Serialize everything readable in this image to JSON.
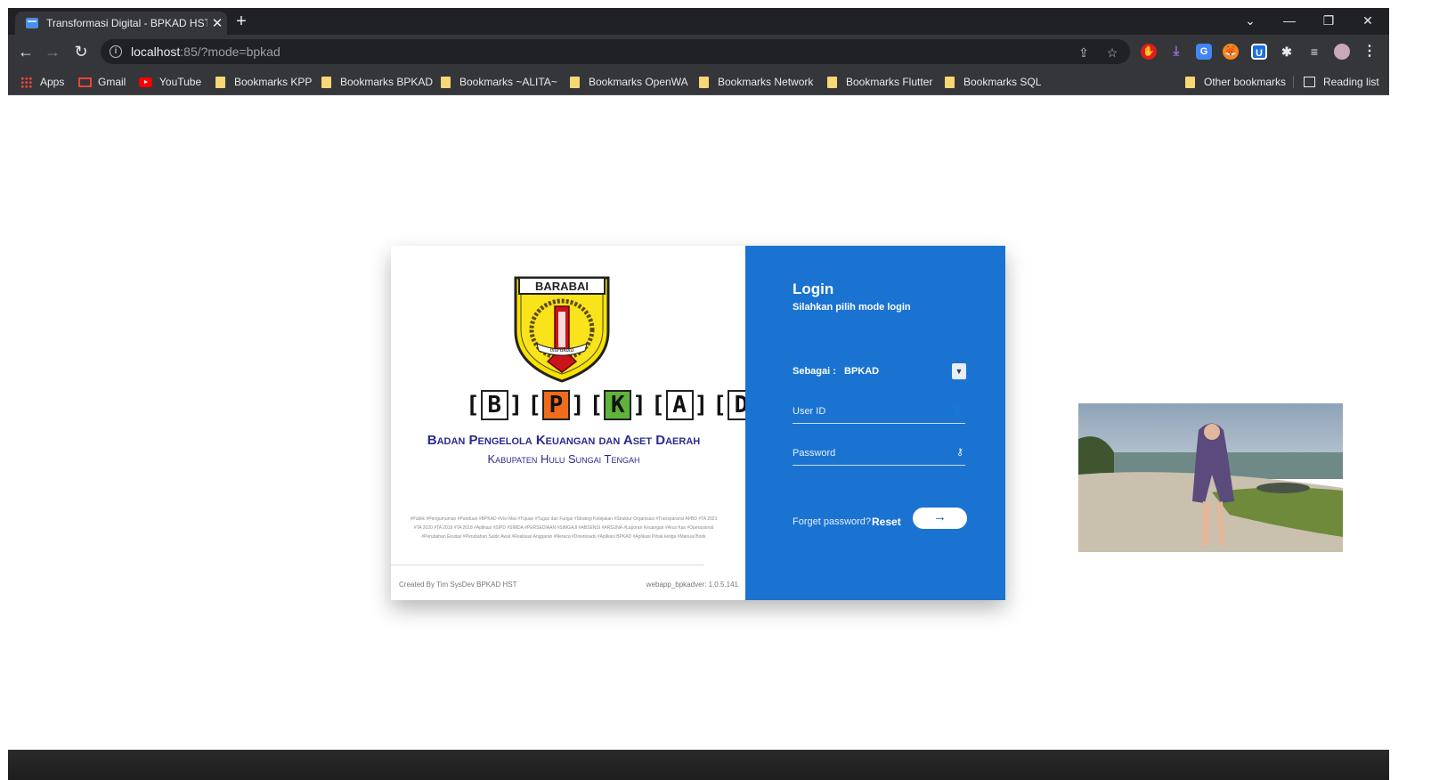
{
  "browser": {
    "tab_title": "Transformasi Digital - BPKAD HST",
    "url_host": "localhost",
    "url_rest": ":85/?mode=bpkad"
  },
  "bookmarks": [
    {
      "label": "Apps",
      "icon": "apps-grid-icon"
    },
    {
      "label": "Gmail",
      "icon": "gmail-icon"
    },
    {
      "label": "YouTube",
      "icon": "youtube-icon"
    },
    {
      "label": "Bookmarks KPP",
      "icon": "folder-icon"
    },
    {
      "label": "Bookmarks BPKAD",
      "icon": "folder-icon"
    },
    {
      "label": "Bookmarks ~ALITA~",
      "icon": "folder-icon"
    },
    {
      "label": "Bookmarks OpenWA",
      "icon": "folder-icon"
    },
    {
      "label": "Bookmarks Network",
      "icon": "folder-icon"
    },
    {
      "label": "Bookmarks Flutter",
      "icon": "folder-icon"
    },
    {
      "label": "Bookmarks SQL",
      "icon": "folder-icon"
    },
    {
      "label": "Other bookmarks",
      "icon": "folder-icon"
    },
    {
      "label": "Reading list",
      "icon": "reading-list-icon"
    }
  ],
  "brand": {
    "crest_top": "BARABAI",
    "crest_ribbon": "murakata",
    "letters": [
      "B",
      "P",
      "K",
      "A",
      "D"
    ],
    "org_name": "Badan Pengelola Keuangan dan Aset Daerah",
    "org_region": "Kabupaten Hulu Sungai Tengah",
    "tags": "#Publik #Pengumuman #Panduan #BPKAD #Visi Misi #Tujuan #Tugas dan Fungsi #Strategi Kebijakan #Struktur Organisasi #Transparansi APBD #TA 2021 #TA 2020 #TA 2019 #TA 2018 #Aplikasi #SIPD #SIMDA #PERSEDIAAN #SIMGAJI #ABSENSI #ARSUNA #Laporan Keuangan #Arus Kas #Operasional #Perubahan Ekuitas #Perubahan Saldo Awal #Realisasi Anggaran #Neraca #Downloads #Aplikasi BPKAD #Aplikasi Pihak ketiga #Manual Book",
    "created_by": "Created By Tim SysDev BPKAD HST",
    "version": "webapp_bpkadver: 1.0.5.141"
  },
  "login": {
    "title": "Login",
    "subtitle": "Silahkan pilih mode login",
    "sebagai_label": "Sebagai :",
    "sebagai_value": "BPKAD",
    "userid_placeholder": "User ID",
    "password_placeholder": "Password",
    "forget_text": "Forget password?",
    "reset_label": "Reset",
    "submit_icon": "arrow-right-icon"
  },
  "colors": {
    "login_panel": "#1a73d1",
    "org_text": "#2a2b8e",
    "p_box": "#ef6c1c",
    "k_box": "#60b33a"
  }
}
